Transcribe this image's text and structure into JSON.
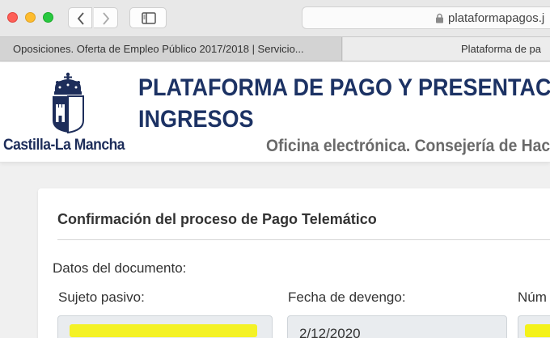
{
  "browser": {
    "url": "plataformapagos.j",
    "tabs": [
      {
        "label": "Oposiciones. Oferta de Empleo Público 2017/2018 | Servicio...",
        "active": false
      },
      {
        "label": "Plataforma de pa",
        "active": true
      }
    ]
  },
  "header": {
    "brand": "Castilla-La Mancha",
    "title_line1": "PLATAFORMA DE PAGO Y PRESENTAC",
    "title_line2": "INGRESOS",
    "subtitle": "Oficina electrónica. Consejería de Hac"
  },
  "content": {
    "card_title": "Confirmación del proceso de Pago Telemático",
    "section_label": "Datos del documento:",
    "fields": [
      {
        "label": "Sujeto pasivo:",
        "value": ""
      },
      {
        "label": "Fecha de devengo:",
        "value": "2/12/2020"
      },
      {
        "label": "Núm",
        "value": ""
      }
    ]
  },
  "colors": {
    "brand_blue": "#1c3264",
    "subtitle_gray": "#6a6a6a",
    "redaction_yellow": "#f4f21a"
  }
}
